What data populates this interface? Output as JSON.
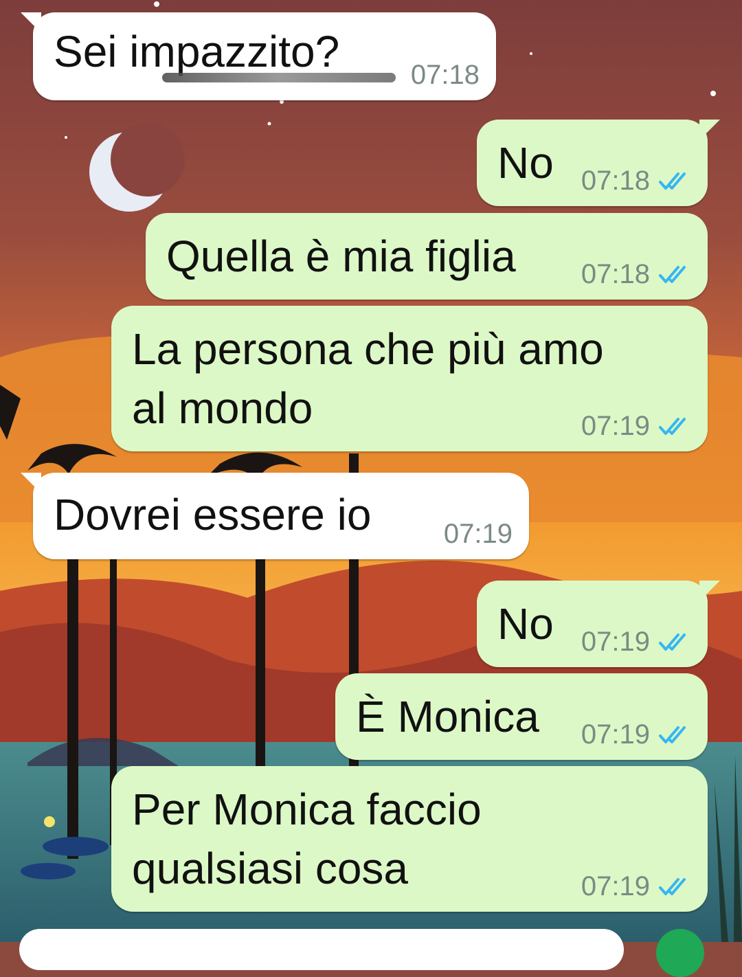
{
  "chat": {
    "messages": [
      {
        "direction": "in",
        "text": "Sei impazzito?",
        "time": "07:18",
        "status": ""
      },
      {
        "direction": "out",
        "text": "No",
        "time": "07:18",
        "status": "read"
      },
      {
        "direction": "out",
        "text": "Quella è mia figlia",
        "time": "07:18",
        "status": "read"
      },
      {
        "direction": "out",
        "text": "La persona che più amo\nal mondo",
        "time": "07:19",
        "status": "read"
      },
      {
        "direction": "in",
        "text": "Dovrei essere io",
        "time": "07:19",
        "status": ""
      },
      {
        "direction": "out",
        "text": "No",
        "time": "07:19",
        "status": "read"
      },
      {
        "direction": "out",
        "text": "È Monica",
        "time": "07:19",
        "status": "read"
      },
      {
        "direction": "out",
        "text": "Per Monica faccio\nqualsiasi cosa",
        "time": "07:19",
        "status": "read"
      }
    ]
  },
  "colors": {
    "incoming_bubble": "#ffffff",
    "outgoing_bubble": "#dcf8c6",
    "read_tick": "#34b7f1",
    "timestamp": "#7b8a84"
  },
  "icons": {
    "read_receipt": "double-check-icon",
    "moon": "crescent-moon-icon"
  }
}
